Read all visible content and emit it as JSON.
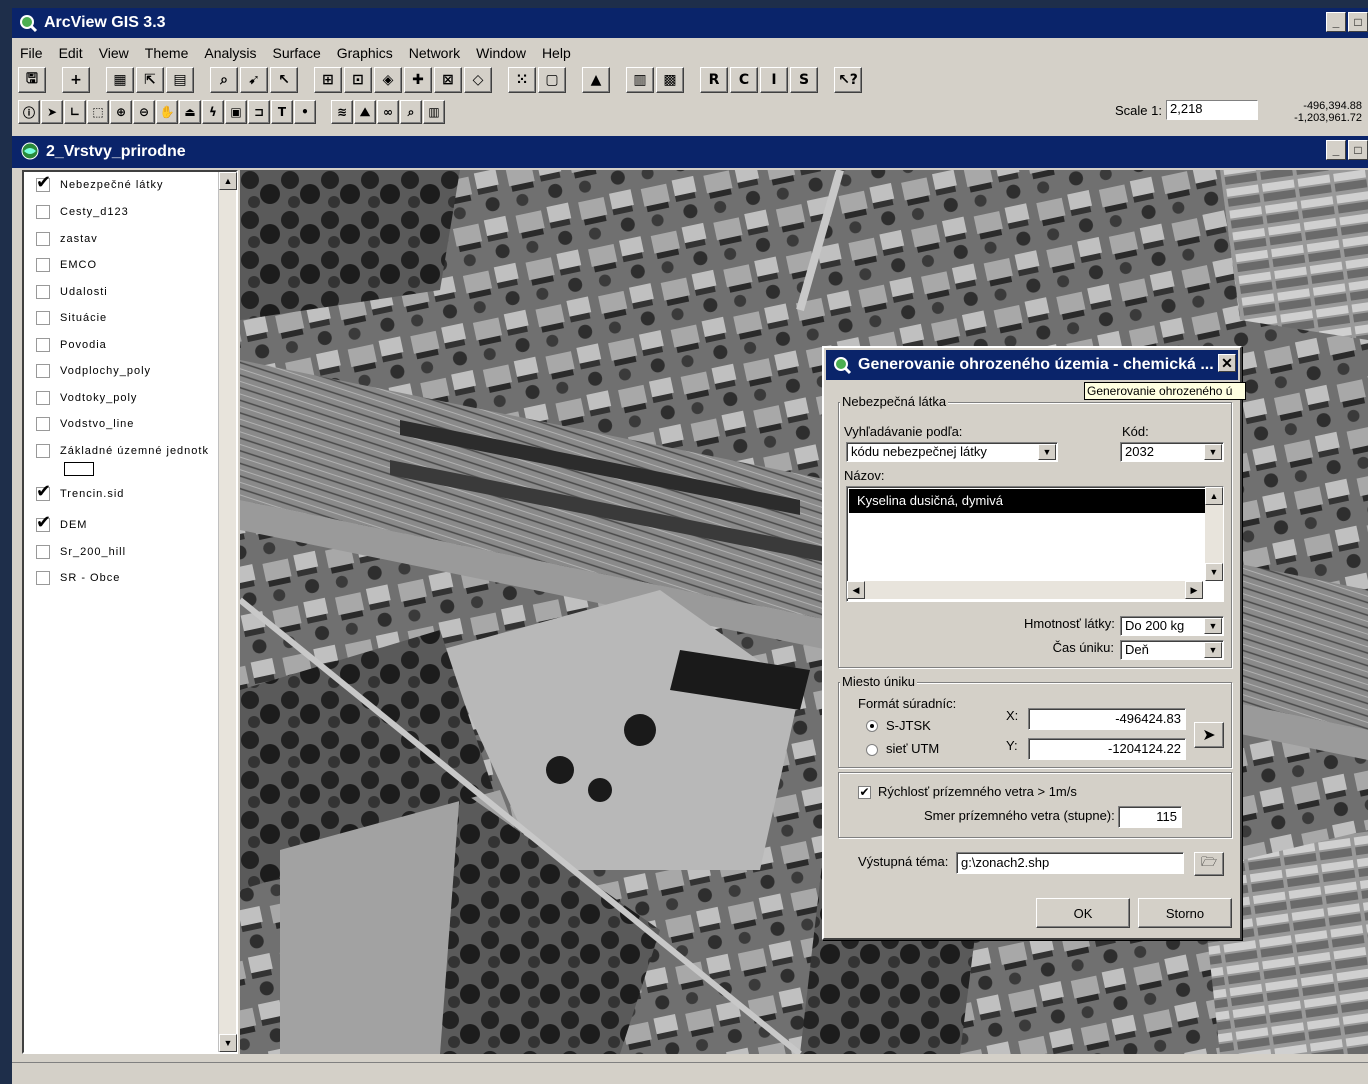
{
  "app": {
    "title": "ArcView GIS 3.3"
  },
  "menu": [
    "File",
    "Edit",
    "View",
    "Theme",
    "Analysis",
    "Surface",
    "Graphics",
    "Network",
    "Window",
    "Help"
  ],
  "toolbar": {
    "text_buttons": [
      "R",
      "C",
      "I",
      "S"
    ]
  },
  "scale": {
    "label": "Scale 1:",
    "value": "2,218"
  },
  "coords": {
    "x": "-496,394.88",
    "y": "-1,203,961.72"
  },
  "view": {
    "title": "2_Vrstvy_prirodne"
  },
  "layers": [
    {
      "name": "Nebezpečné látky",
      "checked": true
    },
    {
      "name": "Cesty_d123",
      "checked": false
    },
    {
      "name": "zastav",
      "checked": false
    },
    {
      "name": "EMCO",
      "checked": false
    },
    {
      "name": "Udalosti",
      "checked": false
    },
    {
      "name": "Situácie",
      "checked": false
    },
    {
      "name": "Povodia",
      "checked": false
    },
    {
      "name": "Vodplochy_poly",
      "checked": false
    },
    {
      "name": "Vodtoky_poly",
      "checked": false
    },
    {
      "name": "Vodstvo_line",
      "checked": false
    },
    {
      "name": "Základné územné jednotk",
      "checked": false
    },
    {
      "name": "Trencin.sid",
      "checked": true
    },
    {
      "name": "DEM",
      "checked": true
    },
    {
      "name": "Sr_200_hill",
      "checked": false
    },
    {
      "name": "SR - Obce",
      "checked": false
    }
  ],
  "dialog": {
    "title": "Generovanie ohrozeného územia - chemická ...",
    "tooltip": "Generovanie ohrozeného ú",
    "group1": "Nebezpečná látka",
    "search_label": "Vyhľadávanie podľa:",
    "search_value": "kódu nebezpečnej látky",
    "code_label": "Kód:",
    "code_value": "2032",
    "name_label": "Názov:",
    "name_selected": "Kyselina dusičná, dymivá",
    "mass_label": "Hmotnosť látky:",
    "mass_value": "Do 200 kg",
    "time_label": "Čas úniku:",
    "time_value": "Deň",
    "group2": "Miesto úniku",
    "format_label": "Formát súradníc:",
    "radio1": "S-JTSK",
    "radio2": "sieť UTM",
    "x_label": "X:",
    "x_value": "-496424.83",
    "y_label": "Y:",
    "y_value": "-1204124.22",
    "wind_check": "Rýchlosť prízemného vetra > 1m/s",
    "wind_dir_label": "Smer prízemného vetra (stupne):",
    "wind_dir_value": "115",
    "output_label": "Výstupná téma:",
    "output_value": "g:\\zonach2.shp",
    "ok": "OK",
    "cancel": "Storno"
  }
}
